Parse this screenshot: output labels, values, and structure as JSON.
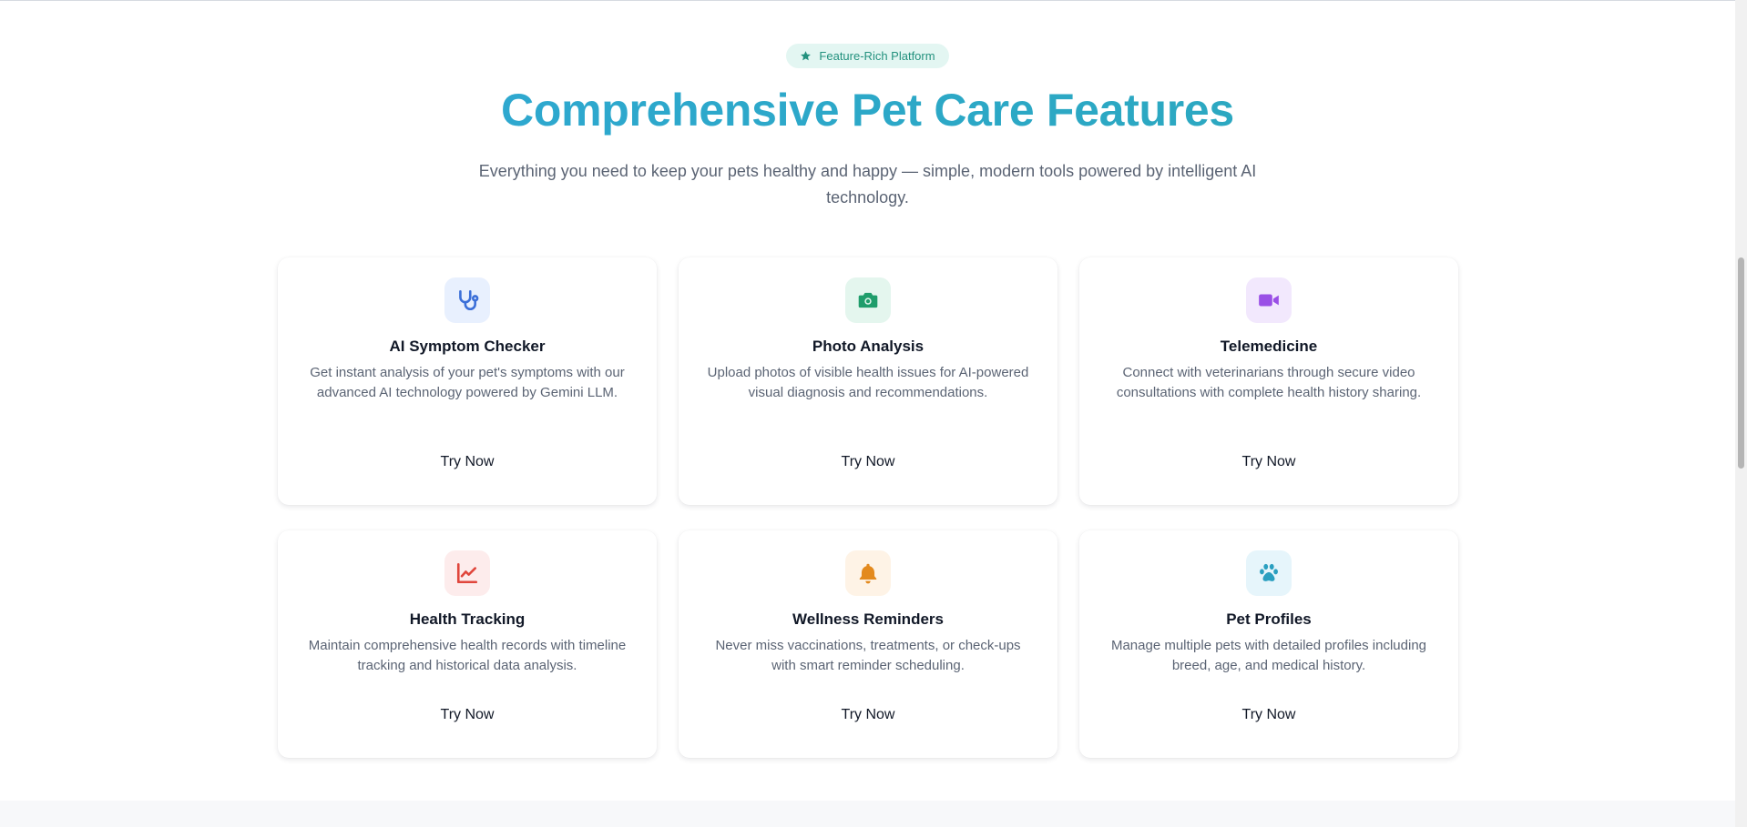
{
  "section": {
    "badge": "Feature-Rich Platform",
    "title": "Comprehensive Pet Care Features",
    "subtitle": "Everything you need to keep your pets healthy and happy — simple, modern tools powered by intelligent AI technology."
  },
  "features": [
    {
      "title": "AI Symptom Checker",
      "description": "Get instant analysis of your pet's symptoms with our advanced AI technology powered by Gemini LLM.",
      "cta": "Try Now",
      "icon": "stethoscope-icon",
      "icon_color": "#3b6fd8",
      "icon_bg": "#e8f0fe"
    },
    {
      "title": "Photo Analysis",
      "description": "Upload photos of visible health issues for AI-pow­ered visual diagnosis and recommendations.",
      "cta": "Try Now",
      "icon": "camera-icon",
      "icon_color": "#1f9d6b",
      "icon_bg": "#e4f6ee"
    },
    {
      "title": "Telemedicine",
      "description": "Connect with veterinarians through secure video consultations with complete health history sharing.",
      "cta": "Try Now",
      "icon": "video-camera-icon",
      "icon_color": "#9a4fe6",
      "icon_bg": "#f2e8fd"
    },
    {
      "title": "Health Tracking",
      "description": "Maintain comprehensive health records with time­line tracking and historical data analysis.",
      "cta": "Try Now",
      "icon": "line-chart-icon",
      "icon_color": "#e0463c",
      "icon_bg": "#fdecec"
    },
    {
      "title": "Wellness Reminders",
      "description": "Never miss vaccinations, treatments, or check-ups with smart reminder scheduling.",
      "cta": "Try Now",
      "icon": "bell-icon",
      "icon_color": "#e38a1e",
      "icon_bg": "#fef3e6"
    },
    {
      "title": "Pet Profiles",
      "description": "Manage multiple pets with detailed profiles includ­ing breed, age, and medical history.",
      "cta": "Try Now",
      "icon": "paw-icon",
      "icon_color": "#2a9fc0",
      "icon_bg": "#e6f5fb"
    }
  ],
  "colors": {
    "badge_bg": "#e3f6f2",
    "badge_text": "#23917e",
    "title_gradient_start": "#2fa9d9",
    "title_gradient_end": "#2aa7b7"
  }
}
